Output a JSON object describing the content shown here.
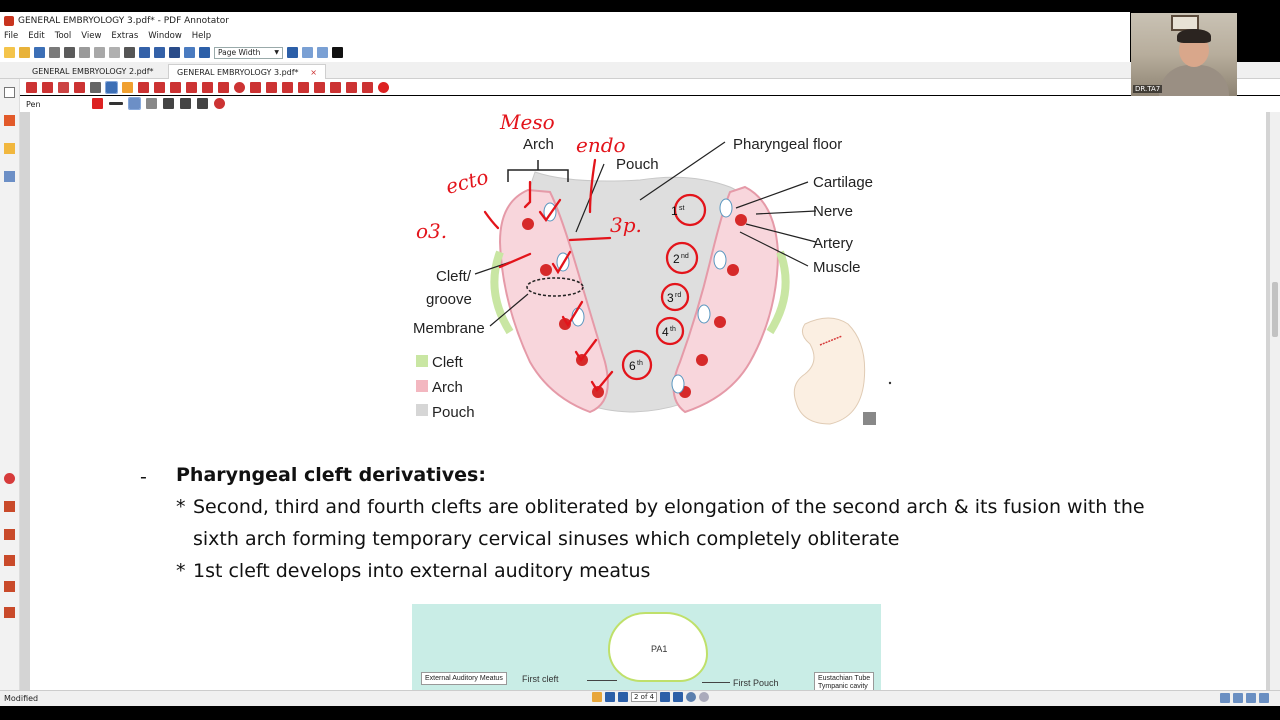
{
  "window": {
    "title": "GENERAL EMBRYOLOGY 3.pdf* - PDF Annotator"
  },
  "menu": [
    "File",
    "Edit",
    "Tool",
    "View",
    "Extras",
    "Window",
    "Help"
  ],
  "toolbar": {
    "zoom_select": "Page Width"
  },
  "tabs": [
    {
      "label": "GENERAL EMBRYOLOGY 2.pdf*",
      "active": false
    },
    {
      "label": "GENERAL EMBRYOLOGY 3.pdf*",
      "active": true
    }
  ],
  "tool_options": {
    "current_tool": "Pen"
  },
  "webcam": {
    "name": "DR.TA7"
  },
  "diagram": {
    "labels": {
      "arch": "Arch",
      "pouch": "Pouch",
      "pharyngeal_floor": "Pharyngeal floor",
      "cartilage": "Cartilage",
      "nerve": "Nerve",
      "artery": "Artery",
      "muscle": "Muscle",
      "cleft_groove_1": "Cleft/",
      "cleft_groove_2": "groove",
      "membrane": "Membrane"
    },
    "legend": [
      {
        "label": "Cleft",
        "color": "#c9e6a3"
      },
      {
        "label": "Arch",
        "color": "#f3b7c0"
      },
      {
        "label": "Pouch",
        "color": "#d6d6d6"
      }
    ],
    "pouch_numbers": [
      {
        "num": "1",
        "sup": "st"
      },
      {
        "num": "2",
        "sup": "nd"
      },
      {
        "num": "3",
        "sup": "rd"
      },
      {
        "num": "4",
        "sup": "th"
      },
      {
        "num": "6",
        "sup": "th"
      }
    ],
    "handwritten": {
      "meso": "Meso",
      "endo": "endo",
      "ecto": "ecto",
      "os": "o3.",
      "three_p": "3p."
    }
  },
  "content": {
    "bullet_dash": "-",
    "heading": "Pharyngeal cleft derivatives:",
    "star": "*",
    "item1_line1": "Second, third and fourth clefts are obliterated by elongation of the second arch & its fusion with the",
    "item1_line2": "sixth arch forming temporary cervical sinuses which completely obliterate",
    "item2": "1st cleft develops into external auditory meatus"
  },
  "bottom_figure": {
    "pa1": "PA1",
    "eam": "External Auditory Meatus",
    "first_cleft": "First cleft",
    "first_pouch": "First Pouch",
    "eustachian_1": "Eustachian Tube",
    "eustachian_2": "Tympanic cavity"
  },
  "status": {
    "text": "Modified",
    "page": "2 of 4"
  },
  "colors": {
    "annotation_red": "#e3141b",
    "accent_blue": "#2c5fa8"
  }
}
